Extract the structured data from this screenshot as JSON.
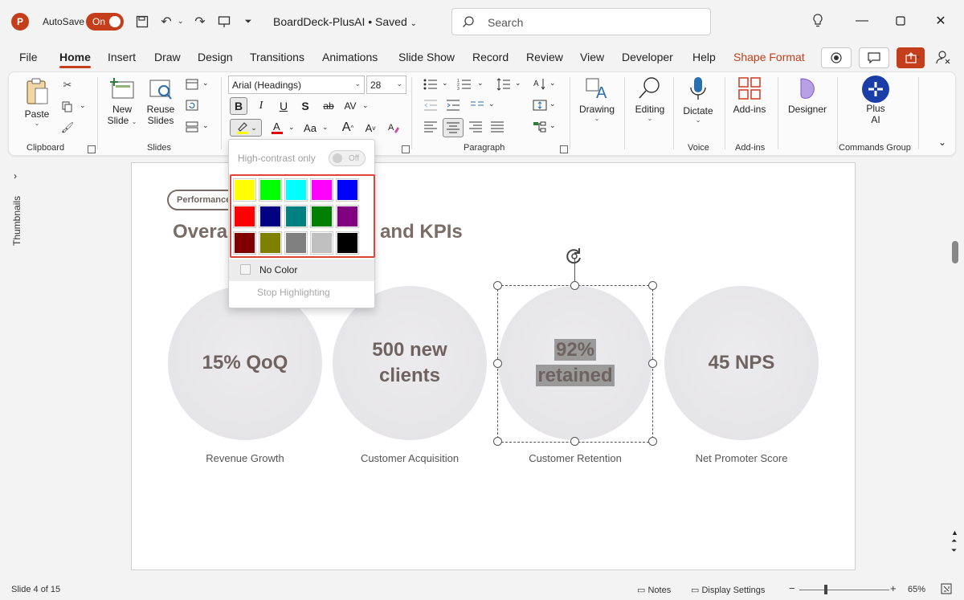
{
  "app": {
    "logo_letter": "P",
    "autosave_label": "AutoSave",
    "autosave_state": "On",
    "doc_name": "BoardDeck-PlusAI • Saved",
    "search_placeholder": "Search",
    "accent_color": "#c43e1c"
  },
  "tabs": [
    "File",
    "Home",
    "Insert",
    "Draw",
    "Design",
    "Transitions",
    "Animations",
    "Slide Show",
    "Record",
    "Review",
    "View",
    "Developer",
    "Help",
    "Shape Format"
  ],
  "active_tab": "Home",
  "ribbon": {
    "clipboard": {
      "paste": "Paste",
      "label": "Clipboard"
    },
    "slides": {
      "new_slide": "New Slide",
      "new_slide_l1": "New",
      "new_slide_l2": "Slide",
      "reuse_l1": "Reuse",
      "reuse_l2": "Slides",
      "label": "Slides"
    },
    "font": {
      "family": "Arial (Headings)",
      "size": "28",
      "bold": "B",
      "italic": "I",
      "underline": "U",
      "strike": "S",
      "strike2": "ab",
      "spacing": "AV",
      "case": "Aa",
      "grow": "A",
      "shrink": "A"
    },
    "paragraph": {
      "label": "Paragraph"
    },
    "drawing": "Drawing",
    "editing": "Editing",
    "voice": {
      "dictate": "Dictate",
      "label": "Voice"
    },
    "addins": {
      "button": "Add-ins",
      "label": "Add-ins"
    },
    "designer": "Designer",
    "plusai": {
      "line1": "Plus",
      "line2": "AI",
      "label": "Commands Group"
    }
  },
  "left_panel": {
    "label": "Thumbnails"
  },
  "slide": {
    "pill": "Performance",
    "title_left": "Overa",
    "title_right": "and KPIs",
    "circles": [
      {
        "text": "15% QoQ",
        "label": "Revenue Growth"
      },
      {
        "text_line1": "500 new",
        "text_line2": "clients",
        "label": "Customer Acquisition"
      },
      {
        "text_line1": "92%",
        "text_line2": "retained",
        "label": "Customer Retention"
      },
      {
        "text": "45 NPS",
        "label": "Net Promoter Score"
      }
    ]
  },
  "highlight_menu": {
    "high_contrast_label": "High-contrast only",
    "toggle_state": "Off",
    "colors": [
      [
        "#ffff00",
        "#00ff00",
        "#00ffff",
        "#ff00ff",
        "#0000ff"
      ],
      [
        "#ff0000",
        "#000080",
        "#008080",
        "#008000",
        "#800080"
      ],
      [
        "#800000",
        "#808000",
        "#808080",
        "#c0c0c0",
        "#000000"
      ]
    ],
    "no_color": "No Color",
    "stop_highlighting": "Stop Highlighting"
  },
  "statusbar": {
    "slide_info": "Slide 4 of 15",
    "notes": "Notes",
    "display_settings": "Display Settings",
    "zoom": "65%",
    "zoom_percent": 65
  }
}
